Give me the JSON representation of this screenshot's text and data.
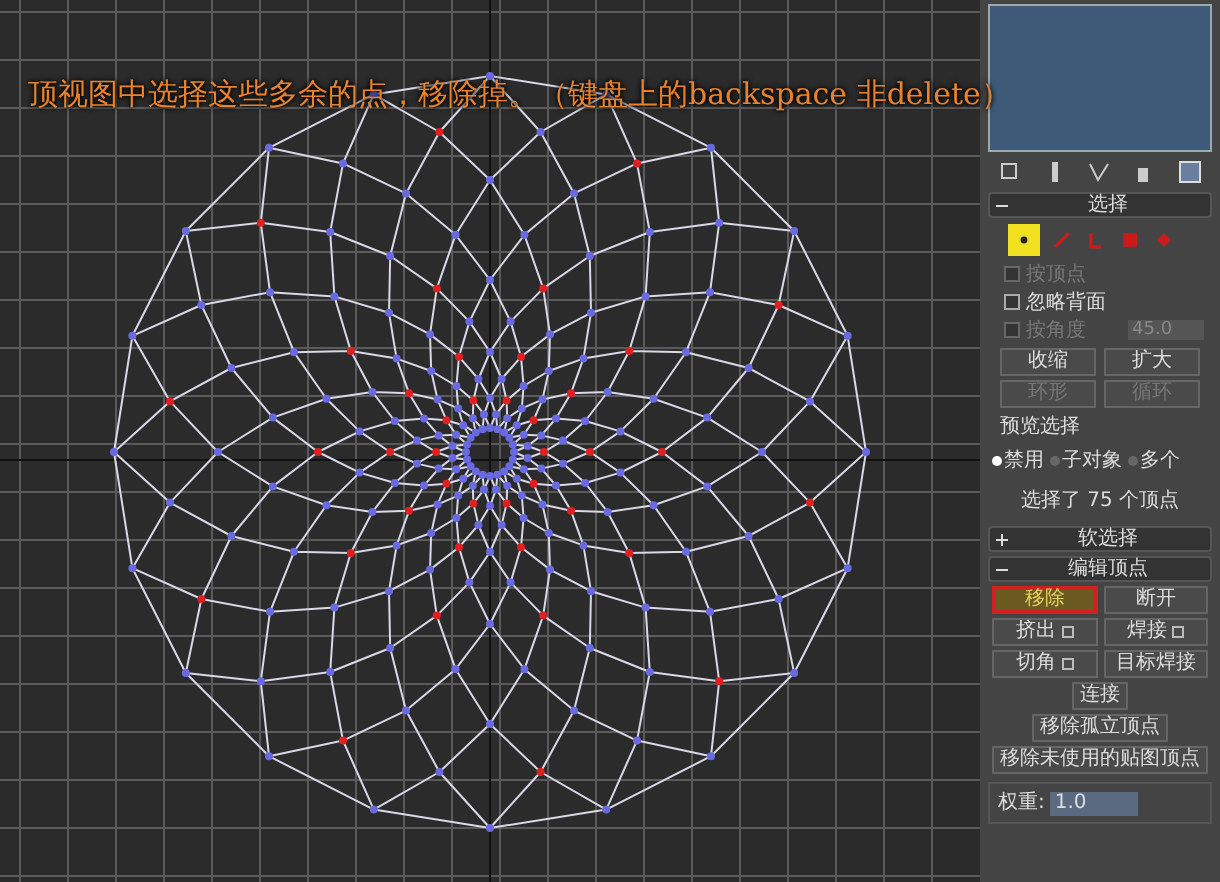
{
  "caption": "顶视图中选择这些多余的点，移除掉。（键盘上的backspace 非delete）",
  "selection": {
    "title": "选择",
    "expanded": true,
    "subobjects": [
      {
        "kind": "vertex",
        "selected": true
      },
      {
        "kind": "edge",
        "selected": false
      },
      {
        "kind": "border",
        "selected": false
      },
      {
        "kind": "polygon",
        "selected": false
      },
      {
        "kind": "element",
        "selected": false
      }
    ],
    "options": [
      {
        "label": "按顶点",
        "checked": false,
        "disabled": true
      },
      {
        "label": "忽略背面",
        "checked": false,
        "disabled": false
      },
      {
        "label": "按角度",
        "checked": false,
        "disabled": true,
        "value": "45.0"
      }
    ],
    "buttons": [
      {
        "label": "收缩",
        "disabled": false
      },
      {
        "label": "扩大",
        "disabled": false
      },
      {
        "label": "环形",
        "disabled": true
      },
      {
        "label": "循环",
        "disabled": true
      }
    ],
    "preview_label": "预览选择",
    "preview": [
      {
        "label": "禁用",
        "selected": true
      },
      {
        "label": "子对象",
        "selected": false
      },
      {
        "label": "多个",
        "selected": false
      }
    ],
    "status": "选择了 75 个顶点"
  },
  "soft_selection": {
    "title": "软选择",
    "expanded": false
  },
  "edit_vertices": {
    "title": "编辑顶点",
    "expanded": true,
    "buttons": [
      {
        "label": "移除",
        "highlighted": true,
        "settings": false
      },
      {
        "label": "断开",
        "highlighted": false,
        "settings": false
      },
      {
        "label": "挤出",
        "highlighted": false,
        "settings": true
      },
      {
        "label": "焊接",
        "highlighted": false,
        "settings": true
      },
      {
        "label": "切角",
        "highlighted": false,
        "settings": true
      },
      {
        "label": "目标焊接",
        "highlighted": false,
        "settings": false
      }
    ],
    "wide_buttons": [
      "连接",
      "移除孤立顶点",
      "移除未使用的贴图顶点"
    ],
    "weight": {
      "label": "权重:",
      "value": "1.0"
    }
  }
}
